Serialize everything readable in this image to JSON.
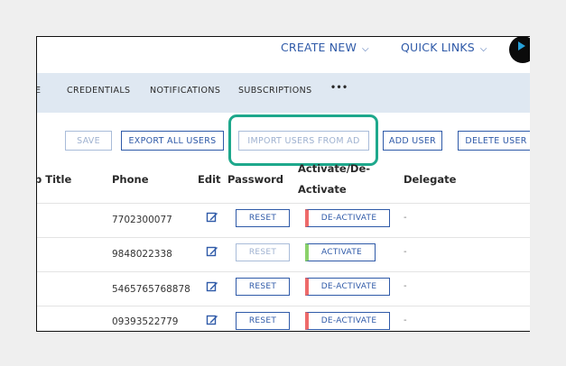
{
  "topbar": {
    "create_new": "CREATE NEW",
    "quick_links": "QUICK LINKS"
  },
  "nav": {
    "items": [
      "E",
      "CREDENTIALS",
      "NOTIFICATIONS",
      "SUBSCRIPTIONS",
      "•••"
    ]
  },
  "toolbar": {
    "save": "SAVE",
    "export_all": "EXPORT ALL USERS",
    "import_ad": "IMPORT USERS FROM AD",
    "add_user": "ADD USER",
    "delete_user": "DELETE USER"
  },
  "table": {
    "headers": {
      "title": "b Title",
      "phone": "Phone",
      "edit": "Edit",
      "password": "Password",
      "activate_line1": "Activate/De-",
      "activate_line2": "Activate",
      "delegate": "Delegate"
    },
    "rows": [
      {
        "phone": "7702300077",
        "reset": "RESET",
        "status": "DE-ACTIVATE",
        "delegate": "-"
      },
      {
        "phone": "9848022338",
        "reset": "RESET",
        "status": "ACTIVATE",
        "delegate": "-"
      },
      {
        "phone": "5465765768878",
        "reset": "RESET",
        "status": "DE-ACTIVATE",
        "delegate": "-"
      },
      {
        "phone": "09393522779",
        "reset": "RESET",
        "status": "DE-ACTIVATE",
        "delegate": "-"
      }
    ]
  },
  "colors": {
    "accent": "#2f5aa8",
    "highlight": "#1ea88c",
    "nav_bg": "#dfe8f2",
    "deactivate_marker": "#ee6a6a",
    "activate_marker": "#8bd26a"
  }
}
